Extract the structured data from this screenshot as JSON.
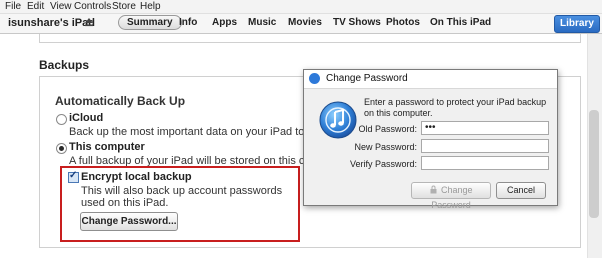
{
  "menu": {
    "items": [
      "File",
      "Edit",
      "View",
      "Controls",
      "Store",
      "Help"
    ]
  },
  "toolbar": {
    "device": "isunshare's iPad",
    "tabs": [
      "Summary",
      "Info",
      "Apps",
      "Music",
      "Movies",
      "TV Shows",
      "Photos",
      "On This iPad"
    ],
    "library": "Library"
  },
  "backups": {
    "title": "Backups",
    "auto_title": "Automatically Back Up",
    "icloud_label": "iCloud",
    "icloud_desc": "Back up the most important data on your iPad to iCloud.",
    "computer_label": "This computer",
    "computer_desc": "A full backup of your iPad will be stored on this computer.",
    "encrypt_label": "Encrypt local backup",
    "encrypt_desc": "This will also back up account passwords used on this iPad.",
    "change_pw_button": "Change Password...",
    "selected": "This computer",
    "encrypt_checked": true
  },
  "dialog": {
    "title": "Change Password",
    "message": "Enter a password to protect your iPad backup on this computer.",
    "old_label": "Old Password:",
    "old_value": "•••",
    "new_label": "New Password:",
    "new_value": "",
    "verify_label": "Verify Password:",
    "verify_value": "",
    "change_button": "Change Password",
    "cancel_button": "Cancel"
  },
  "colors": {
    "accent": "#2a6bc2",
    "highlight_box": "#c81e1e"
  },
  "icons": [
    "eject-icon",
    "itunes-icon",
    "lock-icon"
  ]
}
